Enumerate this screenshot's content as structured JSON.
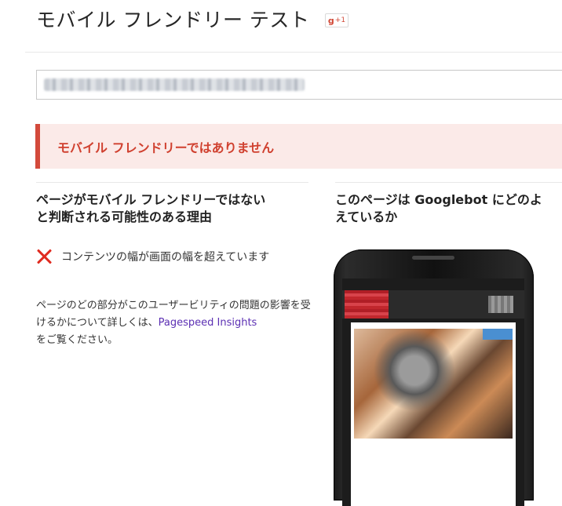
{
  "header": {
    "title": "モバイル フレンドリー テスト",
    "gplus_label": "g",
    "gplus_count": "+1"
  },
  "search": {
    "url_value": ""
  },
  "result": {
    "alert_text": "モバイル フレンドリーではありません"
  },
  "reasons": {
    "heading_line1": "ページがモバイル フレンドリーではない",
    "heading_line2": "と判断される可能性のある理由",
    "issues": [
      {
        "icon": "x-icon",
        "text": "コンテンツの幅が画面の幅を超えています"
      }
    ],
    "explain_before": "ページのどの部分がこのユーザービリティの問題の影響を受けるかについて詳しくは、",
    "explain_link": "Pagespeed Insights",
    "explain_after": "をご覧ください。"
  },
  "preview": {
    "heading_line1": "このページは Googlebot にどのよ",
    "heading_line2": "えているか"
  },
  "colors": {
    "alert_text": "#d0402f",
    "alert_bg": "#fbeae8",
    "alert_border": "#d34a3b",
    "link": "#5b2fb3",
    "error_icon": "#e02b20"
  }
}
